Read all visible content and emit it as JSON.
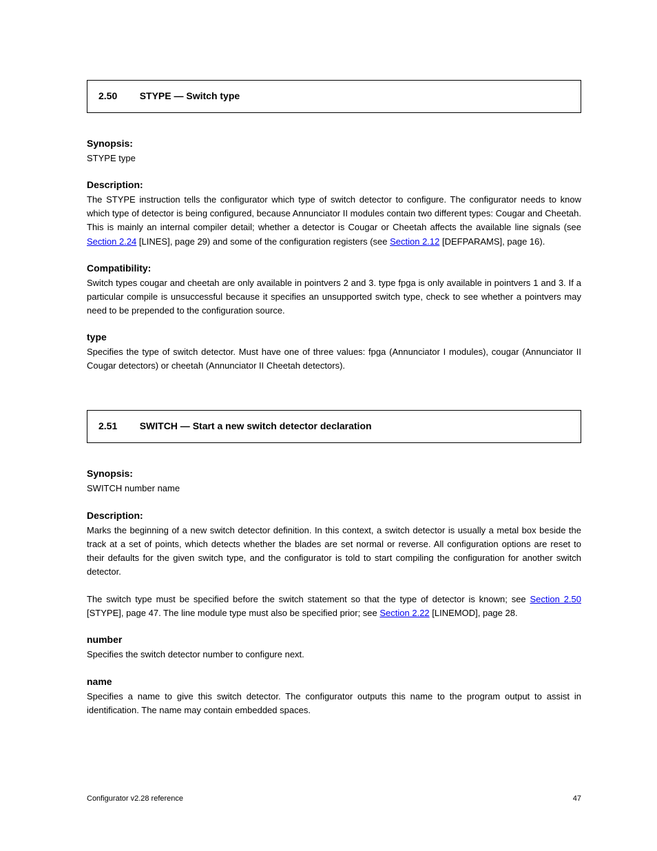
{
  "section1": {
    "number": "2.50",
    "title": "STYPE — Switch type",
    "synopsis_label": "Synopsis:",
    "synopsis_code": "STYPE type",
    "description_label": "Description:",
    "description_html": "The STYPE instruction tells the configurator which type of switch detector to configure. The configurator needs to know which type of detector is being configured, because Annunciator II modules contain two different types: Cougar and Cheetah. This is mainly an internal compiler detail; whether a detector is Cougar or Cheetah affects the available line signals (see <a>Section 2.24</a> [LINES], page 29) and some of the configuration registers (see <a>Section 2.12</a> [DEFPARAMS], page 16).",
    "compat_label": "Compatibility:",
    "compat_text": "Switch types cougar and cheetah are only available in pointvers 2 and 3. type fpga is only available in pointvers 1 and 3. If a particular compile is unsuccessful because it specifies an unsupported switch type, check to see whether a pointvers may need to be prepended to the configuration source.",
    "arg_type_label": "type",
    "arg_type_text": "Specifies the type of switch detector. Must have one of three values: fpga (Annunciator I modules), cougar (Annunciator II Cougar detectors) or cheetah (Annunciator II Cheetah detectors)."
  },
  "section2": {
    "number": "2.51",
    "title": "SWITCH — Start a new switch detector declaration",
    "synopsis_label": "Synopsis:",
    "synopsis_code": "SWITCH number name",
    "description_label": "Description:",
    "description_html": "Marks the beginning of a new switch detector definition. In this context, a switch detector is usually a metal box beside the track at a set of points, which detects whether the blades are set normal or reverse. All configuration options are reset to their defaults for the given switch type, and the configurator is told to start compiling the configuration for another switch detector.",
    "desc2_html": "The switch type must be specified before the switch statement so that the type of detector is known; see <a>Section 2.50</a> [STYPE], page 47. The line module type must also be specified prior; see <a>Section 2.22</a> [LINEMOD], page 28.",
    "arg_number_label": "number",
    "arg_number_text": "Specifies the switch detector number to configure next.",
    "arg_name_label": "name",
    "arg_name_text": "Specifies a name to give this switch detector. The configurator outputs this name to the program output to assist in identification. The name may contain embedded spaces."
  },
  "footer": {
    "left": "Configurator v2.28 reference",
    "right": "47"
  }
}
